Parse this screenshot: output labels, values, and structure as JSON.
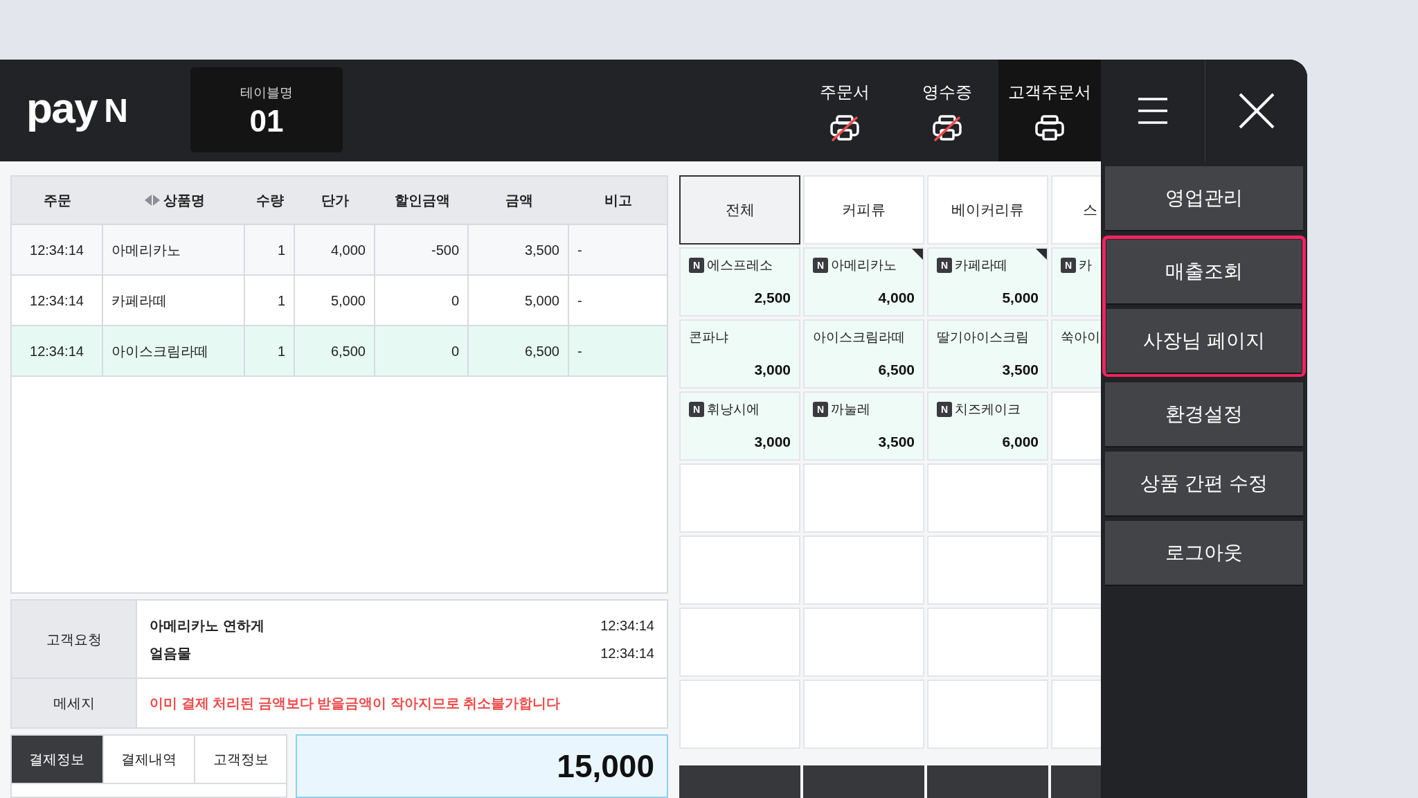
{
  "header": {
    "logo": {
      "text": "pay",
      "mark": "N"
    },
    "table_label": "테이블명",
    "table_number": "01",
    "printers": [
      {
        "label": "주문서",
        "on": false
      },
      {
        "label": "영수증",
        "on": false
      },
      {
        "label": "고객주문서",
        "on": true
      }
    ]
  },
  "order_table": {
    "columns": [
      "주문",
      "상품명",
      "수량",
      "단가",
      "할인금액",
      "금액",
      "비고"
    ],
    "rows": [
      {
        "cells": [
          "12:34:14",
          "아메리카노",
          "1",
          "4,000",
          "-500",
          "3,500",
          "-"
        ],
        "selected": false
      },
      {
        "cells": [
          "12:34:14",
          "카페라떼",
          "1",
          "5,000",
          "0",
          "5,000",
          "-"
        ],
        "selected": false
      },
      {
        "cells": [
          "12:34:14",
          "아이스크림라떼",
          "1",
          "6,500",
          "0",
          "6,500",
          "-"
        ],
        "selected": true
      }
    ]
  },
  "customer_request": {
    "label": "고객요청",
    "entries": [
      {
        "text": "아메리카노 연하게",
        "time": "12:34:14"
      },
      {
        "text": "얼음물",
        "time": "12:34:14"
      }
    ]
  },
  "message": {
    "label": "메세지",
    "text": "이미 결제 처리된 금액보다 받을금액이 작아지므로 취소불가합니다"
  },
  "bottom_tabs": [
    {
      "label": "결제정보",
      "selected": true
    },
    {
      "label": "결제내역",
      "selected": false
    },
    {
      "label": "고객정보",
      "selected": false
    }
  ],
  "total": "15,000",
  "categories": [
    {
      "label": "전체",
      "selected": true
    },
    {
      "label": "커피류",
      "selected": false
    },
    {
      "label": "베이커리류",
      "selected": false
    },
    {
      "label": "스",
      "selected": false
    }
  ],
  "products": [
    {
      "name": "에스프레소",
      "price": "2,500",
      "badge": "N",
      "marked": false
    },
    {
      "name": "아메리카노",
      "price": "4,000",
      "badge": "N",
      "marked": true
    },
    {
      "name": "카페라떼",
      "price": "5,000",
      "badge": "N",
      "marked": true
    },
    {
      "name": "카",
      "badge": "N"
    },
    {
      "name": "콘파냐",
      "price": "3,000",
      "marked": false
    },
    {
      "name": "아이스크림라떼",
      "price": "6,500",
      "marked": false
    },
    {
      "name": "딸기아이스크림",
      "price": "3,500",
      "marked": false
    },
    {
      "name": "쑥아이"
    },
    {
      "name": "휘낭시에",
      "price": "3,000",
      "badge": "N",
      "marked": false
    },
    {
      "name": "까눌레",
      "price": "3,500",
      "badge": "N",
      "marked": false
    },
    {
      "name": "치즈케이크",
      "price": "6,000",
      "badge": "N",
      "marked": false
    }
  ],
  "menu": [
    {
      "label": "영업관리",
      "highlighted": false
    },
    {
      "label": "매출조회",
      "highlighted": true
    },
    {
      "label": "사장님 페이지",
      "highlighted": true
    },
    {
      "label": "환경설정",
      "highlighted": false
    },
    {
      "label": "상품 간편 수정",
      "highlighted": false
    },
    {
      "label": "로그아웃",
      "highlighted": false
    }
  ]
}
